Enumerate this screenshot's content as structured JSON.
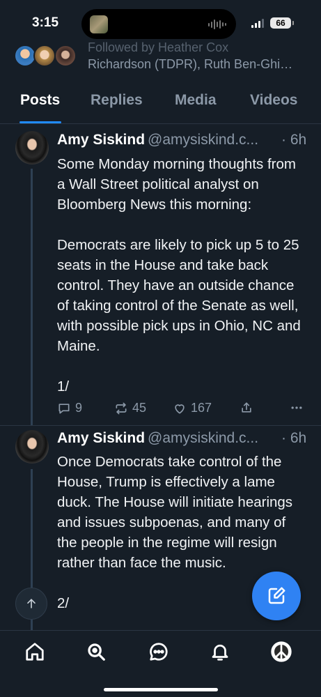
{
  "status_bar": {
    "time": "3:15",
    "battery": "66"
  },
  "profile": {
    "followed_by_line1": "Followed by Heather Cox",
    "followed_by_line2": "Richardson (TDPR), Ruth Ben-Ghi…"
  },
  "tabs": [
    {
      "label": "Posts",
      "active": true
    },
    {
      "label": "Replies",
      "active": false
    },
    {
      "label": "Media",
      "active": false
    },
    {
      "label": "Videos",
      "active": false
    }
  ],
  "posts": [
    {
      "author": "Amy Siskind",
      "handle": "@amysiskind.c...",
      "ago": "· 6h",
      "text": "Some Monday morning thoughts from a Wall Street political analyst on Bloomberg News this morning:\n\nDemocrats are likely to pick up 5 to 25 seats in the House and take back control. They have an outside chance of taking control of the Senate as well, with possible pick ups in Ohio, NC and Maine.\n\n1/",
      "replies": "9",
      "reposts": "45",
      "likes": "167"
    },
    {
      "author": "Amy Siskind",
      "handle": "@amysiskind.c...",
      "ago": "· 6h",
      "text": "Once Democrats take control of the House, Trump is effectively a lame duck. The House will initiate hearings and issues subpoenas, and many of the people in the regime will resign rather than face the music.\n\n2/"
    }
  ],
  "colors": {
    "background": "#161e27",
    "accent": "#208bfe",
    "fab": "#2f82f3",
    "muted_text": "#8c99a8"
  },
  "icons": [
    "reply-icon",
    "repost-icon",
    "like-icon",
    "share-icon",
    "more-icon",
    "compose-icon",
    "arrow-up-icon",
    "home-icon",
    "search-icon",
    "chat-icon",
    "bell-icon",
    "peace-icon"
  ]
}
